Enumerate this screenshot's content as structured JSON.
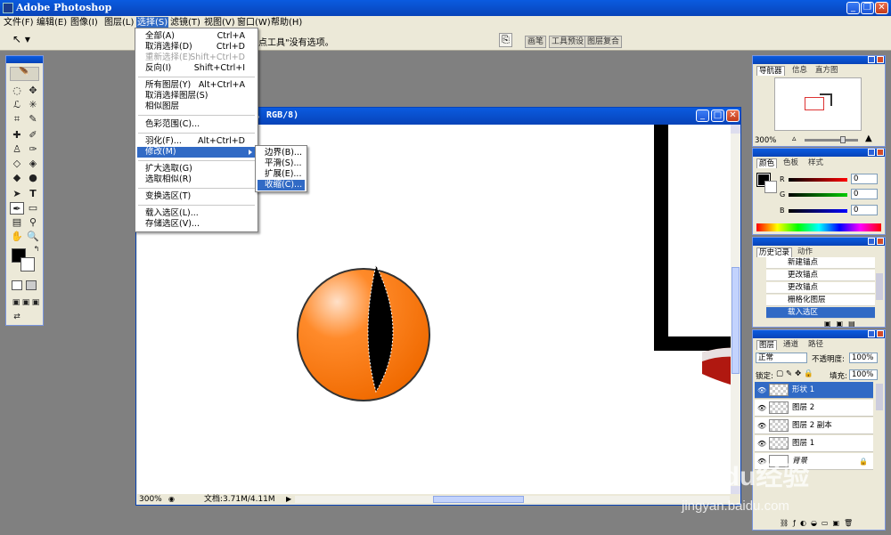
{
  "app": {
    "title": "Adobe Photoshop"
  },
  "menubar": {
    "items": [
      "文件(F)",
      "编辑(E)",
      "图像(I)",
      "图层(L)",
      "选择(S)",
      "滤镜(T)",
      "视图(V)",
      "窗口(W)",
      "帮助(H)"
    ]
  },
  "options": {
    "hint": "点工具\"没有选项。",
    "tabs": [
      "画笔",
      "工具预设",
      "图层复合"
    ]
  },
  "select_menu": {
    "items": [
      {
        "label": "全部(A)",
        "shortcut": "Ctrl+A"
      },
      {
        "label": "取消选择(D)",
        "shortcut": "Ctrl+D"
      },
      {
        "label": "重新选择(E)",
        "shortcut": "Shift+Ctrl+D"
      },
      {
        "label": "反向(I)",
        "shortcut": "Shift+Ctrl+I"
      },
      {
        "label": "所有图层(Y)",
        "shortcut": "Alt+Ctrl+A"
      },
      {
        "label": "取消选择图层(S)",
        "shortcut": ""
      },
      {
        "label": "相似图层",
        "shortcut": ""
      },
      {
        "label": "色彩范围(C)...",
        "shortcut": ""
      },
      {
        "label": "羽化(F)...",
        "shortcut": "Alt+Ctrl+D"
      },
      {
        "label": "修改(M)",
        "shortcut": ""
      },
      {
        "label": "扩大选取(G)",
        "shortcut": ""
      },
      {
        "label": "选取相似(R)",
        "shortcut": ""
      },
      {
        "label": "变换选区(T)",
        "shortcut": ""
      },
      {
        "label": "载入选区(L)...",
        "shortcut": ""
      },
      {
        "label": "存储选区(V)...",
        "shortcut": ""
      }
    ]
  },
  "modify_submenu": {
    "items": [
      "边界(B)...",
      "平滑(S)...",
      "扩展(E)...",
      "收缩(C)..."
    ]
  },
  "document": {
    "title": ", RGB/8)",
    "zoom": "300%",
    "doc_size": "文档:3.71M/4.11M",
    "colors": {
      "orange": "#ff7a10",
      "black": "#000000",
      "red": "#c0201a"
    }
  },
  "navigator": {
    "tabs": [
      "导航器",
      "信息",
      "直方图"
    ],
    "zoom": "300%"
  },
  "color_panel": {
    "tabs": [
      "颜色",
      "色板",
      "样式"
    ],
    "channels": [
      {
        "label": "R",
        "value": "0"
      },
      {
        "label": "G",
        "value": "0"
      },
      {
        "label": "B",
        "value": "0"
      }
    ]
  },
  "history_panel": {
    "tabs": [
      "历史记录",
      "动作"
    ],
    "items": [
      "新建锚点",
      "更改锚点",
      "更改锚点",
      "栅格化图层",
      "载入选区"
    ]
  },
  "layers_panel": {
    "tabs": [
      "图层",
      "通道",
      "路径"
    ],
    "blend_mode": "正常",
    "opacity_label": "不透明度:",
    "opacity": "100%",
    "lock_label": "锁定:",
    "fill_label": "填充:",
    "fill": "100%",
    "layers": [
      "形状 1",
      "图层 2",
      "图层 2 副本",
      "图层 1",
      "背景"
    ]
  },
  "watermark": {
    "brand": "Baidu经验",
    "url": "jingyan.baidu.com"
  }
}
